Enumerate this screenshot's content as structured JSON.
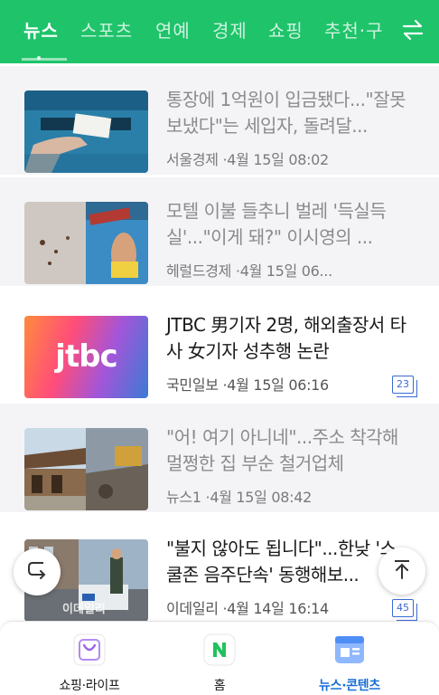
{
  "top_nav": {
    "tabs": [
      "뉴스",
      "스포츠",
      "연예",
      "경제",
      "쇼핑",
      "추천·구"
    ],
    "active_index": 0,
    "swap_icon": "swap-arrows-icon",
    "colors": {
      "bar": "#1ec36a"
    }
  },
  "articles": [
    {
      "title": "통장에 1억원이 입금됐다...\"잘못 보냈다\"는 세입자, 돌려달...",
      "source": "서울경제",
      "time": "4월 15일 08:02",
      "comments": ""
    },
    {
      "title": "모텔 이불 들추니 벌레 '득실득실'...\"이게 돼?\" 이시영의 ...",
      "source": "헤럴드경제",
      "time": "4월 15일 06...",
      "comments": ""
    },
    {
      "title": "JTBC 男기자 2명, 해외출장서 타사 女기자 성추행 논란",
      "source": "국민일보",
      "time": "4월 15일 06:16",
      "comments": "23"
    },
    {
      "title": "\"어! 여기 아니네\"...주소 착각해 멀쩡한 집 부순 철거업체",
      "source": "뉴스1",
      "time": "4월 15일 08:42",
      "comments": ""
    },
    {
      "title": "\"불지 않아도 됩니다\"...한낮 '스쿨존 음주단속' 동행해보...",
      "source": "이데일리",
      "time": "4월 14일 16:14",
      "comments": "45"
    }
  ],
  "thumb_logo_text": "jtbc",
  "thumb_watermark": "이데일리",
  "floating": {
    "left_icon": "return-arrow-icon",
    "right_icon": "arrow-up-icon"
  },
  "bottom_nav": [
    {
      "label": "쇼핑·라이프",
      "icon": "shopping-bag-icon"
    },
    {
      "label": "홈",
      "icon": "naver-n-icon"
    },
    {
      "label": "뉴스·콘텐츠",
      "icon": "news-card-icon"
    }
  ]
}
